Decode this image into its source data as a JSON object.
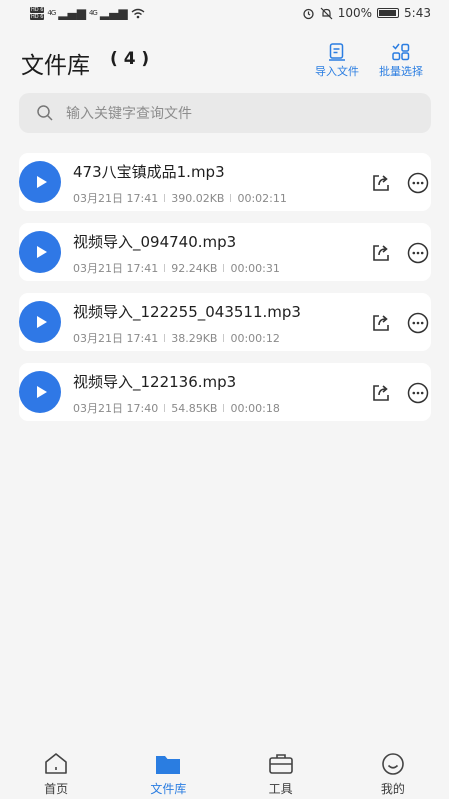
{
  "status_bar": {
    "hd1": "HD 6",
    "hd2": "HD 6",
    "net1": "4G",
    "net2": "4G",
    "battery": "100%",
    "time": "5:43"
  },
  "header": {
    "title": "文件库",
    "count": "( 4 )",
    "import_label": "导入文件",
    "batch_label": "批量选择"
  },
  "search": {
    "placeholder": "输入关键字查询文件"
  },
  "files": [
    {
      "name": "473八宝镇成品1.mp3",
      "date": "03月21日 17:41",
      "size": "390.02KB",
      "duration": "00:02:11"
    },
    {
      "name": "视频导入_094740.mp3",
      "date": "03月21日 17:41",
      "size": "92.24KB",
      "duration": "00:00:31"
    },
    {
      "name": "视频导入_122255_043511.mp3",
      "date": "03月21日 17:41",
      "size": "38.29KB",
      "duration": "00:00:12"
    },
    {
      "name": "视频导入_122136.mp3",
      "date": "03月21日 17:40",
      "size": "54.85KB",
      "duration": "00:00:18"
    }
  ],
  "tabbar": {
    "home": "首页",
    "library": "文件库",
    "tools": "工具",
    "mine": "我的"
  },
  "colors": {
    "accent": "#2a7de1",
    "play": "#2f78e6",
    "background": "#f5f5f5"
  },
  "icons": [
    "alarm-icon",
    "mute-icon",
    "wifi-icon",
    "search-icon",
    "import-icon",
    "batch-select-icon",
    "play-icon",
    "share-icon",
    "more-icon",
    "home-icon",
    "folder-icon",
    "toolbox-icon",
    "smile-icon"
  ]
}
